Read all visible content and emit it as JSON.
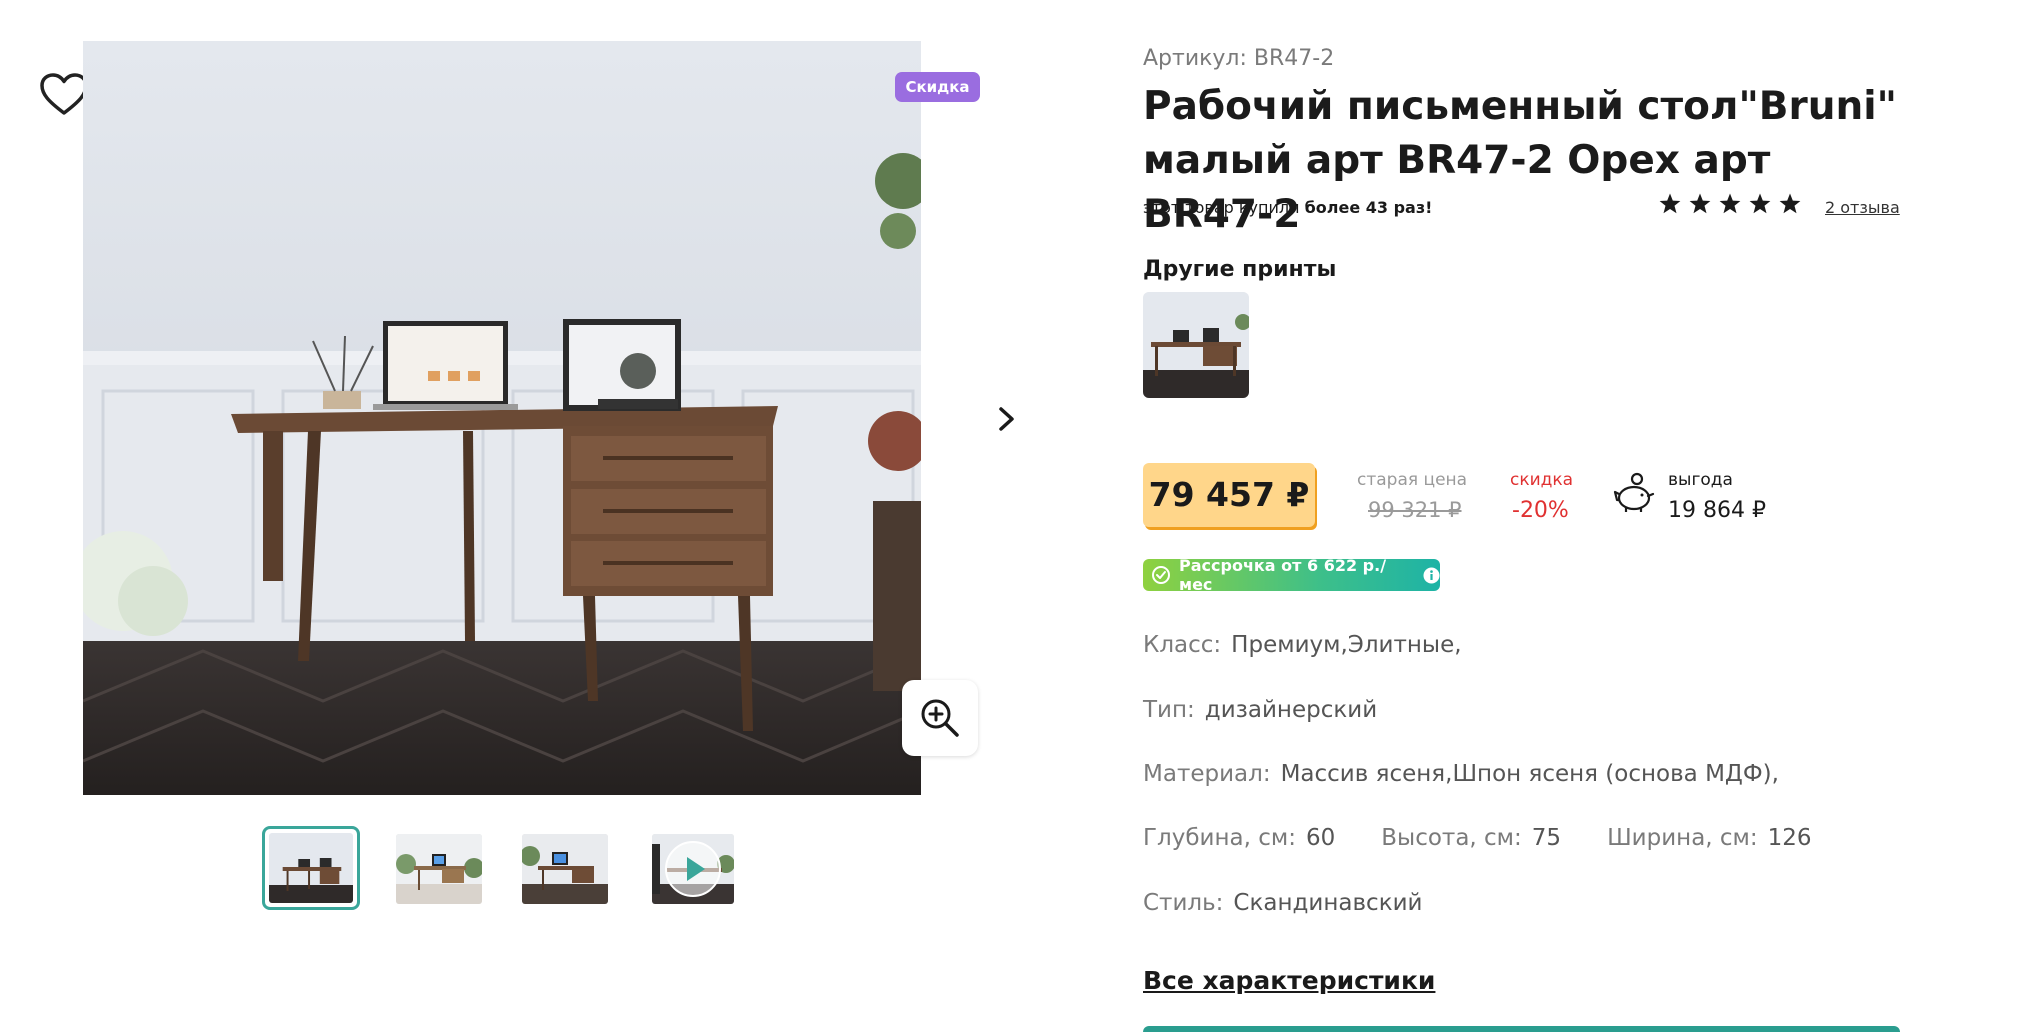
{
  "gallery": {
    "badge": "Скидка",
    "icons": {
      "favorite": "heart-icon",
      "next": "chevron-right-icon",
      "zoom": "zoom-in-icon",
      "play": "play-icon"
    },
    "thumbnails_count": 4,
    "active_thumbnail": 1
  },
  "product": {
    "sku_label": "Артикул: BR47-2",
    "title_line1": "Рабочий письменный стол\"Bruni\"",
    "title_line2": "малый арт BR47-2 Орех арт BR47-2",
    "bought_prefix": "этот товар купили ",
    "bought_bold": "более 43 раз!",
    "rating": 5,
    "reviews_link": "2 отзыва",
    "other_prints_label": "Другие принты"
  },
  "price": {
    "current": "79 457 ₽",
    "old_label": "старая цена",
    "old": "99 321 ₽",
    "discount_label": "скидка",
    "discount": "-20%",
    "benefit_label": "выгода",
    "benefit": "19 864 ₽",
    "installment": "Рассрочка от 6 622 р./мес"
  },
  "specs": {
    "class_label": "Класс:",
    "class_value": "Премиум,Элитные,",
    "type_label": "Тип:",
    "type_value": "дизайнерский",
    "material_label": "Материал:",
    "material_value": "Массив ясеня,Шпон ясеня (основа МДФ),",
    "depth_label": "Глубина, см:",
    "depth_value": "60",
    "height_label": "Высота, см:",
    "height_value": "75",
    "width_label": "Ширина, см:",
    "width_value": "126",
    "style_label": "Стиль:",
    "style_value": "Скандинавский"
  },
  "all_specs_link": "Все характеристики",
  "colors": {
    "accent": "#3aa69a",
    "badge": "#9a6de0",
    "price_bg": "#ffd68a",
    "discount": "#e03131"
  }
}
